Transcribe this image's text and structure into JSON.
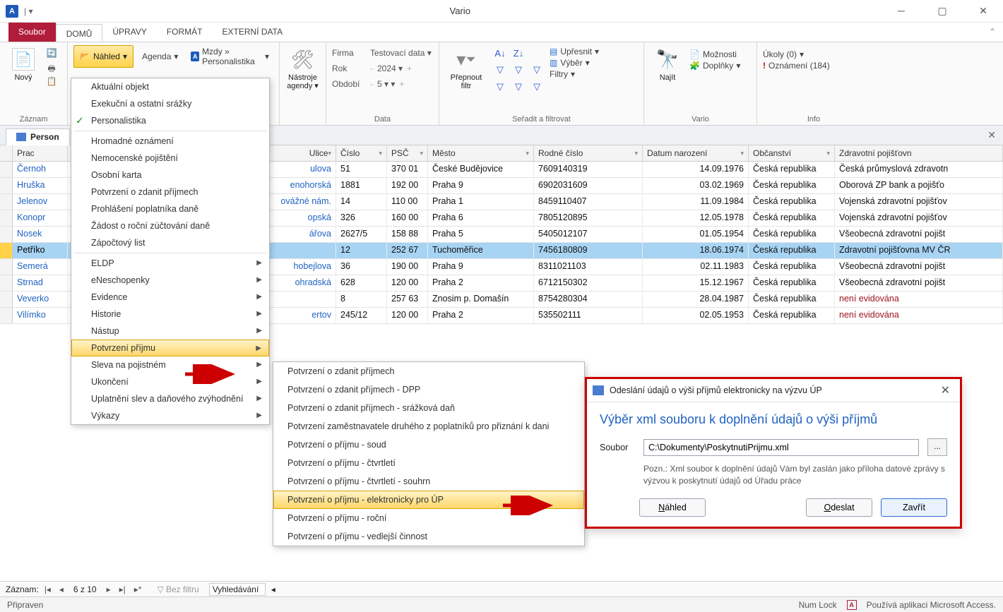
{
  "title": "Vario",
  "tabs": {
    "file": "Soubor",
    "home": "DOMŮ",
    "edits": "ÚPRAVY",
    "format": "FORMÁT",
    "ext": "EXTERNÍ DATA"
  },
  "ribbon": {
    "newLabel": "Nový",
    "recordLabel": "Záznam",
    "nahled": "Náhled",
    "agenda": "Agenda",
    "breadcrumb": "Mzdy » Personalistika",
    "nastroje": "Nástroje agendy",
    "dataGroup": "Data",
    "firma": "Firma",
    "firmaVal": "Testovací data",
    "rok": "Rok",
    "rokVal": "2024",
    "obdobi": "Období",
    "obdobiVal": "5",
    "prepFilter": "Přepnout filtr",
    "sortGroup": "Seřadit a filtrovat",
    "upresnit": "Upřesnit",
    "vyber": "Výběr",
    "filtry": "Filtry",
    "najit": "Najít",
    "varioGroup": "Vario",
    "moznosti": "Možnosti",
    "doplnky": "Doplňky",
    "ukoly": "Úkoly (0)",
    "oznameni": "Oznámení (184)",
    "infoGroup": "Info"
  },
  "docTab": "Person",
  "columns": {
    "prac": "Prac",
    "ulice": "Ulice",
    "cislo": "Číslo",
    "psc": "PSČ",
    "mesto": "Město",
    "rc": "Rodné číslo",
    "dob": "Datum narození",
    "obc": "Občanství",
    "zdr": "Zdravotní pojišťovn"
  },
  "rows": [
    {
      "name": "Černoh",
      "street": "ulova",
      "num": "51",
      "psc": "370 01",
      "city": "České Budějovice",
      "rc": "7609140319",
      "dob": "14.09.1976",
      "obc": "Česká republika",
      "zdr": "Česká průmyslová zdravotn"
    },
    {
      "name": "Hruška",
      "street": "enohorská",
      "num": "1881",
      "psc": "192 00",
      "city": "Praha 9",
      "rc": "6902031609",
      "dob": "03.02.1969",
      "obc": "Česká republika",
      "zdr": "Oborová ZP bank a pojišťo"
    },
    {
      "name": "Jelenov",
      "street": "ovážné nám.",
      "num": "14",
      "psc": "110 00",
      "city": "Praha 1",
      "rc": "8459110407",
      "dob": "11.09.1984",
      "obc": "Česká republika",
      "zdr": "Vojenská zdravotní pojišťov"
    },
    {
      "name": "Konopr",
      "street": "opská",
      "num": "326",
      "psc": "160 00",
      "city": "Praha 6",
      "rc": "7805120895",
      "dob": "12.05.1978",
      "obc": "Česká republika",
      "zdr": "Vojenská zdravotní pojišťov"
    },
    {
      "name": "Nosek",
      "street": "ářova",
      "num": "2627/5",
      "psc": "158 88",
      "city": "Praha 5",
      "rc": "5405012107",
      "dob": "01.05.1954",
      "obc": "Česká republika",
      "zdr": "Všeobecná zdravotní pojišt"
    },
    {
      "name": "Petříko",
      "street": "",
      "num": "12",
      "psc": "252 67",
      "city": "Tuchoměřice",
      "rc": "7456180809",
      "dob": "18.06.1974",
      "obc": "Česká republika",
      "zdr": "Zdravotní pojišťovna MV ČR",
      "sel": true
    },
    {
      "name": "Semerá",
      "street": "hobejlova",
      "num": "36",
      "psc": "190 00",
      "city": "Praha 9",
      "rc": "8311021103",
      "dob": "02.11.1983",
      "obc": "Česká republika",
      "zdr": "Všeobecná zdravotní pojišt"
    },
    {
      "name": "Strnad",
      "street": "ohradská",
      "num": "628",
      "psc": "120 00",
      "city": "Praha 2",
      "rc": "6712150302",
      "dob": "15.12.1967",
      "obc": "Česká republika",
      "zdr": "Všeobecná zdravotní pojišt"
    },
    {
      "name": "Veverko",
      "street": "",
      "num": "8",
      "psc": "257 63",
      "city": "Znosim p. Domašín",
      "rc": "8754280304",
      "dob": "28.04.1987",
      "obc": "Česká republika",
      "zdr": "není evidována",
      "nev": true
    },
    {
      "name": "Vilímko",
      "street": "ertov",
      "num": "245/12",
      "psc": "120 00",
      "city": "Praha 2",
      "rc": "535502111",
      "dob": "02.05.1953",
      "obc": "Česká republika",
      "zdr": "není evidována",
      "nev": true
    }
  ],
  "menu1": [
    {
      "t": "Aktuální objekt"
    },
    {
      "t": "Exekuční a ostatní srážky"
    },
    {
      "t": "Personalistika",
      "check": true
    },
    {
      "sep": true
    },
    {
      "t": "Hromadné oznámení"
    },
    {
      "t": "Nemocenské pojištění"
    },
    {
      "t": "Osobní karta"
    },
    {
      "t": "Potvrzení o zdanit příjmech"
    },
    {
      "t": "Prohlášení poplatníka daně"
    },
    {
      "t": "Žádost o roční zúčtování daně"
    },
    {
      "t": "Zápočtový list"
    },
    {
      "sep": true
    },
    {
      "t": "ELDP",
      "sub": true
    },
    {
      "t": "eNeschopenky",
      "sub": true
    },
    {
      "t": "Evidence",
      "sub": true
    },
    {
      "t": "Historie",
      "sub": true
    },
    {
      "t": "Nástup",
      "sub": true
    },
    {
      "t": "Potvrzení příjmu",
      "sub": true,
      "hl": true
    },
    {
      "t": "Sleva na pojistném",
      "sub": true
    },
    {
      "t": "Ukončení",
      "sub": true
    },
    {
      "t": "Uplatnění slev a daňového zvýhodnění",
      "sub": true
    },
    {
      "t": "Výkazy",
      "sub": true
    }
  ],
  "menu2": [
    {
      "t": "Potvrzení o zdanit příjmech"
    },
    {
      "t": "Potvrzení o zdanit příjmech - DPP"
    },
    {
      "t": "Potvrzení o zdanit příjmech - srážková daň"
    },
    {
      "t": "Potvrzení zaměstnavatele druhého z poplatníků pro přiznání k dani"
    },
    {
      "t": "Potvrzení o příjmu - soud"
    },
    {
      "t": "Potvrzení o příjmu - čtvrtletí"
    },
    {
      "t": "Potvrzení o příjmu - čtvrtletí - souhrn"
    },
    {
      "t": "Potvrzení o příjmu - elektronicky pro ÚP",
      "hl": true
    },
    {
      "t": "Potvrzení o příjmu - roční"
    },
    {
      "t": "Potvrzení o příjmu - vedlejší činnost"
    }
  ],
  "dialog": {
    "title": "Odeslání údajů o výši příjmů elektronicky na výzvu ÚP",
    "heading": "Výběr xml souboru k doplnění údajů o výši příjmů",
    "souborLbl": "Soubor",
    "souborVal": "C:\\Dokumenty\\PoskytnutiPrijmu.xml",
    "note": "Pozn.: Xml soubor k doplnění údajů Vám byl zaslán jako příloha datové zprávy s výzvou k poskytnutí údajů od Úřadu práce",
    "nahled": "Náhled",
    "odeslat": "Odeslat",
    "zavrit": "Zavřít"
  },
  "recnav": {
    "label": "Záznam:",
    "pos": "6 z 10",
    "nofilter": "Bez filtru",
    "search": "Vyhledávání"
  },
  "status": {
    "ready": "Připraven",
    "numlock": "Num Lock",
    "access": "Používá aplikaci Microsoft Access."
  }
}
